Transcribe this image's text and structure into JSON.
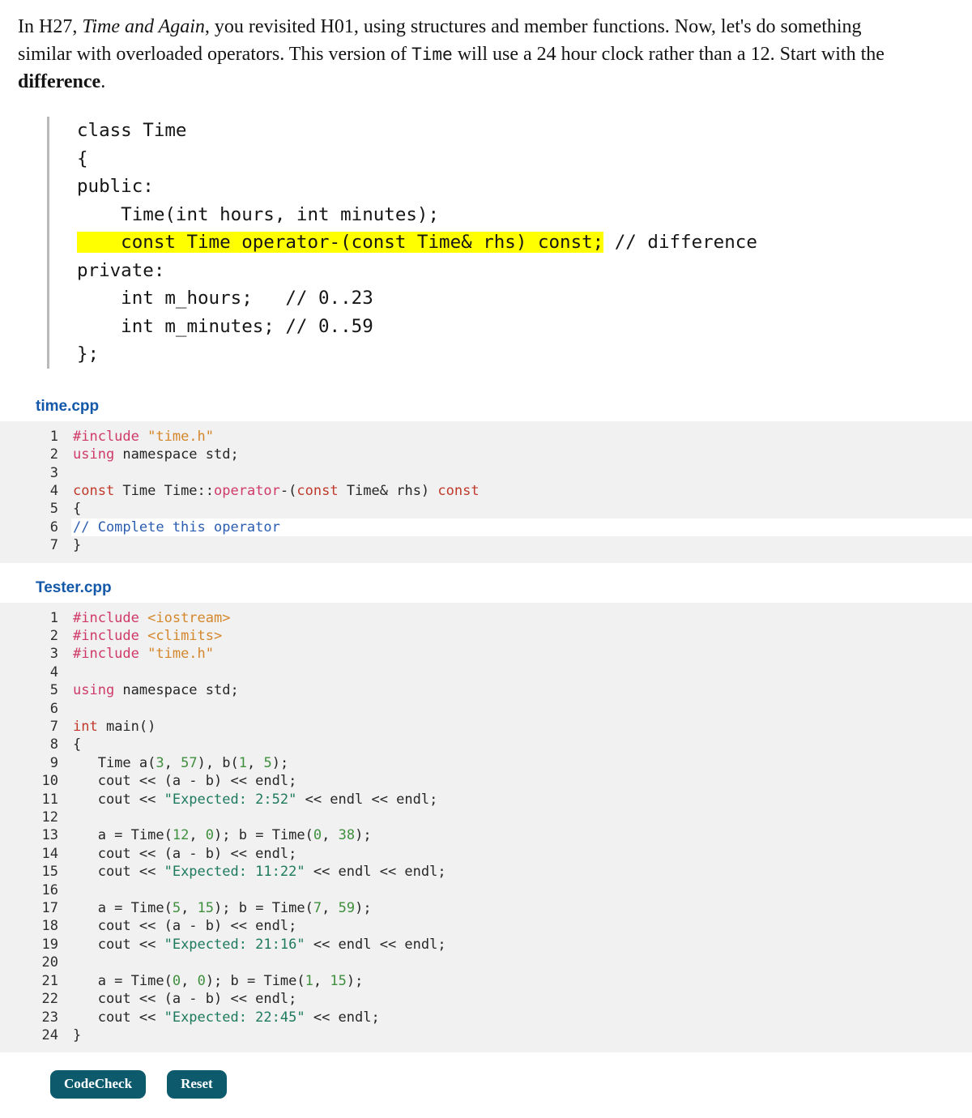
{
  "intro": {
    "part1": "In H27, ",
    "italic1": "Time and Again",
    "part2": ", you revisited H01, using structures and member functions. Now, let's do something similar with overloaded operators. This version of ",
    "mono1": "Time",
    "part3": " will use a 24 hour clock rather than a 12. Start with the ",
    "bold1": "difference",
    "part4": "."
  },
  "header_code": {
    "line1": "class Time",
    "line2": "{",
    "line3": "public:",
    "line4": "    Time(int hours, int minutes);",
    "line5_highlight": "    const Time operator-(const Time& rhs) const;",
    "line5_comment": " // difference",
    "line6": "private:",
    "line7": "    int m_hours;   // 0..23",
    "line8": "    int m_minutes; // 0..59",
    "line9": "};"
  },
  "time_cpp": {
    "label": "time.cpp",
    "lines": [
      {
        "n": "1",
        "editable": false,
        "tokens": [
          {
            "t": "#include ",
            "c": "t-pre"
          },
          {
            "t": "\"time.h\"",
            "c": "t-inc"
          }
        ]
      },
      {
        "n": "2",
        "editable": false,
        "tokens": [
          {
            "t": "using",
            "c": "t-kw2"
          },
          {
            "t": " namespace std;",
            "c": "t-plain"
          }
        ]
      },
      {
        "n": "3",
        "editable": false,
        "tokens": [
          {
            "t": "",
            "c": "t-plain"
          }
        ]
      },
      {
        "n": "4",
        "editable": false,
        "tokens": [
          {
            "t": "const",
            "c": "t-kw"
          },
          {
            "t": " Time Time::",
            "c": "t-plain"
          },
          {
            "t": "operator",
            "c": "t-kw2"
          },
          {
            "t": "-(",
            "c": "t-plain"
          },
          {
            "t": "const",
            "c": "t-kw"
          },
          {
            "t": " Time& rhs) ",
            "c": "t-plain"
          },
          {
            "t": "const",
            "c": "t-kw"
          }
        ]
      },
      {
        "n": "5",
        "editable": false,
        "tokens": [
          {
            "t": "{",
            "c": "t-plain"
          }
        ]
      },
      {
        "n": "6",
        "editable": true,
        "tokens": [
          {
            "t": "// Complete this operator",
            "c": "t-cmt"
          }
        ]
      },
      {
        "n": "7",
        "editable": false,
        "tokens": [
          {
            "t": "}",
            "c": "t-plain"
          }
        ]
      }
    ]
  },
  "tester_cpp": {
    "label": "Tester.cpp",
    "lines": [
      {
        "n": "1",
        "editable": false,
        "tokens": [
          {
            "t": "#include ",
            "c": "t-pre"
          },
          {
            "t": "<iostream>",
            "c": "t-inc"
          }
        ]
      },
      {
        "n": "2",
        "editable": false,
        "tokens": [
          {
            "t": "#include ",
            "c": "t-pre"
          },
          {
            "t": "<climits>",
            "c": "t-inc"
          }
        ]
      },
      {
        "n": "3",
        "editable": false,
        "tokens": [
          {
            "t": "#include ",
            "c": "t-pre"
          },
          {
            "t": "\"time.h\"",
            "c": "t-inc"
          }
        ]
      },
      {
        "n": "4",
        "editable": false,
        "tokens": [
          {
            "t": "",
            "c": "t-plain"
          }
        ]
      },
      {
        "n": "5",
        "editable": false,
        "tokens": [
          {
            "t": "using",
            "c": "t-kw2"
          },
          {
            "t": " namespace std;",
            "c": "t-plain"
          }
        ]
      },
      {
        "n": "6",
        "editable": false,
        "tokens": [
          {
            "t": "",
            "c": "t-plain"
          }
        ]
      },
      {
        "n": "7",
        "editable": false,
        "tokens": [
          {
            "t": "int",
            "c": "t-kw"
          },
          {
            "t": " main()",
            "c": "t-plain"
          }
        ]
      },
      {
        "n": "8",
        "editable": false,
        "tokens": [
          {
            "t": "{",
            "c": "t-plain"
          }
        ]
      },
      {
        "n": "9",
        "editable": false,
        "tokens": [
          {
            "t": "   Time a(",
            "c": "t-plain"
          },
          {
            "t": "3",
            "c": "t-num"
          },
          {
            "t": ", ",
            "c": "t-plain"
          },
          {
            "t": "57",
            "c": "t-num"
          },
          {
            "t": "), b(",
            "c": "t-plain"
          },
          {
            "t": "1",
            "c": "t-num"
          },
          {
            "t": ", ",
            "c": "t-plain"
          },
          {
            "t": "5",
            "c": "t-num"
          },
          {
            "t": ");",
            "c": "t-plain"
          }
        ]
      },
      {
        "n": "10",
        "editable": false,
        "tokens": [
          {
            "t": "   cout << (a - b) << endl;",
            "c": "t-plain"
          }
        ]
      },
      {
        "n": "11",
        "editable": false,
        "tokens": [
          {
            "t": "   cout << ",
            "c": "t-plain"
          },
          {
            "t": "\"Expected: 2:52\"",
            "c": "t-str"
          },
          {
            "t": " << endl << endl;",
            "c": "t-plain"
          }
        ]
      },
      {
        "n": "12",
        "editable": false,
        "tokens": [
          {
            "t": "",
            "c": "t-plain"
          }
        ]
      },
      {
        "n": "13",
        "editable": false,
        "tokens": [
          {
            "t": "   a = Time(",
            "c": "t-plain"
          },
          {
            "t": "12",
            "c": "t-num"
          },
          {
            "t": ", ",
            "c": "t-plain"
          },
          {
            "t": "0",
            "c": "t-num"
          },
          {
            "t": "); b = Time(",
            "c": "t-plain"
          },
          {
            "t": "0",
            "c": "t-num"
          },
          {
            "t": ", ",
            "c": "t-plain"
          },
          {
            "t": "38",
            "c": "t-num"
          },
          {
            "t": ");",
            "c": "t-plain"
          }
        ]
      },
      {
        "n": "14",
        "editable": false,
        "tokens": [
          {
            "t": "   cout << (a - b) << endl;",
            "c": "t-plain"
          }
        ]
      },
      {
        "n": "15",
        "editable": false,
        "tokens": [
          {
            "t": "   cout << ",
            "c": "t-plain"
          },
          {
            "t": "\"Expected: 11:22\"",
            "c": "t-str"
          },
          {
            "t": " << endl << endl;",
            "c": "t-plain"
          }
        ]
      },
      {
        "n": "16",
        "editable": false,
        "tokens": [
          {
            "t": "",
            "c": "t-plain"
          }
        ]
      },
      {
        "n": "17",
        "editable": false,
        "tokens": [
          {
            "t": "   a = Time(",
            "c": "t-plain"
          },
          {
            "t": "5",
            "c": "t-num"
          },
          {
            "t": ", ",
            "c": "t-plain"
          },
          {
            "t": "15",
            "c": "t-num"
          },
          {
            "t": "); b = Time(",
            "c": "t-plain"
          },
          {
            "t": "7",
            "c": "t-num"
          },
          {
            "t": ", ",
            "c": "t-plain"
          },
          {
            "t": "59",
            "c": "t-num"
          },
          {
            "t": ");",
            "c": "t-plain"
          }
        ]
      },
      {
        "n": "18",
        "editable": false,
        "tokens": [
          {
            "t": "   cout << (a - b) << endl;",
            "c": "t-plain"
          }
        ]
      },
      {
        "n": "19",
        "editable": false,
        "tokens": [
          {
            "t": "   cout << ",
            "c": "t-plain"
          },
          {
            "t": "\"Expected: 21:16\"",
            "c": "t-str"
          },
          {
            "t": " << endl << endl;",
            "c": "t-plain"
          }
        ]
      },
      {
        "n": "20",
        "editable": false,
        "tokens": [
          {
            "t": "",
            "c": "t-plain"
          }
        ]
      },
      {
        "n": "21",
        "editable": false,
        "tokens": [
          {
            "t": "   a = Time(",
            "c": "t-plain"
          },
          {
            "t": "0",
            "c": "t-num"
          },
          {
            "t": ", ",
            "c": "t-plain"
          },
          {
            "t": "0",
            "c": "t-num"
          },
          {
            "t": "); b = Time(",
            "c": "t-plain"
          },
          {
            "t": "1",
            "c": "t-num"
          },
          {
            "t": ", ",
            "c": "t-plain"
          },
          {
            "t": "15",
            "c": "t-num"
          },
          {
            "t": ");",
            "c": "t-plain"
          }
        ]
      },
      {
        "n": "22",
        "editable": false,
        "tokens": [
          {
            "t": "   cout << (a - b) << endl;",
            "c": "t-plain"
          }
        ]
      },
      {
        "n": "23",
        "editable": false,
        "tokens": [
          {
            "t": "   cout << ",
            "c": "t-plain"
          },
          {
            "t": "\"Expected: 22:45\"",
            "c": "t-str"
          },
          {
            "t": " << endl;",
            "c": "t-plain"
          }
        ]
      },
      {
        "n": "24",
        "editable": false,
        "tokens": [
          {
            "t": "}",
            "c": "t-plain"
          }
        ]
      }
    ]
  },
  "buttons": {
    "codecheck_label": "CodeCheck",
    "reset_label": "Reset"
  },
  "colors": {
    "accent_blue": "#1459a9",
    "button_teal": "#0d5a6d",
    "highlight_yellow": "#ffff00",
    "code_bg": "#f1f1f1",
    "editable_bg": "#ffffff"
  }
}
